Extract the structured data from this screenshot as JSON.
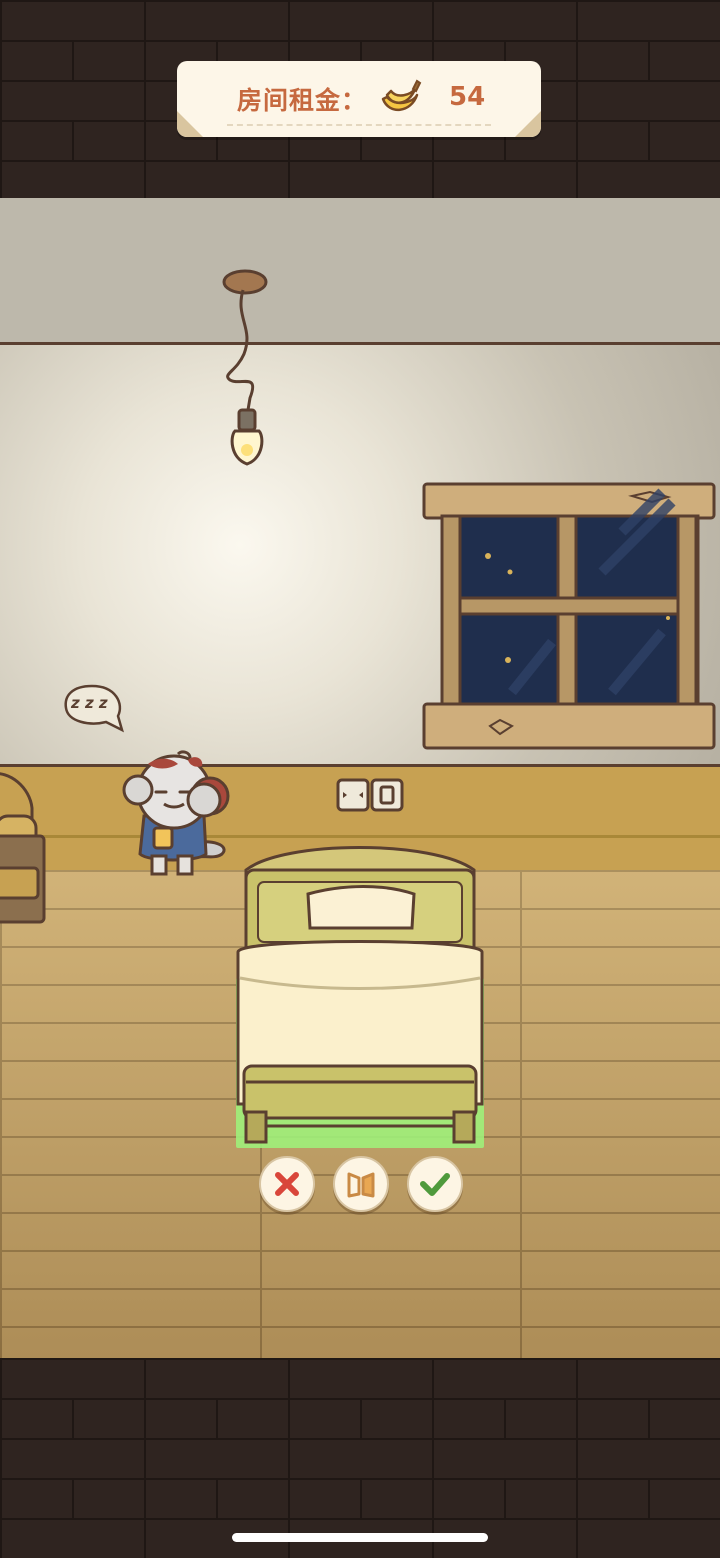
{
  "rent_panel": {
    "label": "房间租金：",
    "currency_icon": "banana-icon",
    "value": "54"
  },
  "room": {
    "speech_bubble_text": "z z z",
    "speech_bubble_icon": "sleep-bubble-icon"
  },
  "actions": {
    "cancel_icon": "close-icon",
    "flip_icon": "flip-icon",
    "confirm_icon": "check-icon"
  },
  "colors": {
    "accent": "#c6693f",
    "cancel": "#d9463a",
    "confirm": "#4f9a3c",
    "placement_highlight": "#9ff07a"
  }
}
